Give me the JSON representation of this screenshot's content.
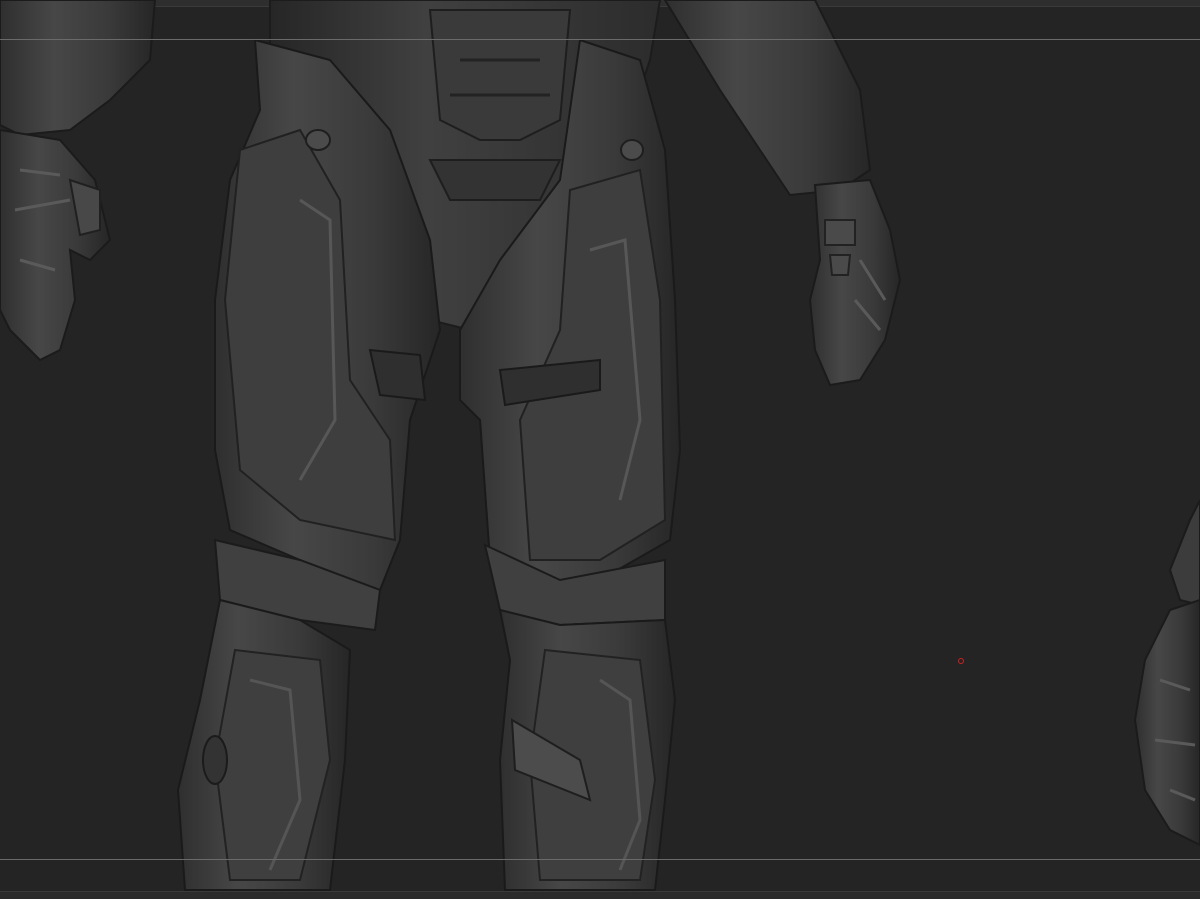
{
  "viewport": {
    "background": "#242424",
    "model_color": "#3b3b3b",
    "highlight_color": "#565656",
    "shadow_color": "#1c1c1c",
    "guide_color": "#6a6a6a",
    "cursor_color": "#d02020"
  },
  "model": {
    "subject": "armored-character-sculpt",
    "parts": [
      "left-hand",
      "right-hand",
      "left-thigh",
      "right-thigh",
      "left-shin",
      "right-shin",
      "torso-lower",
      "side-model-fragment"
    ]
  }
}
